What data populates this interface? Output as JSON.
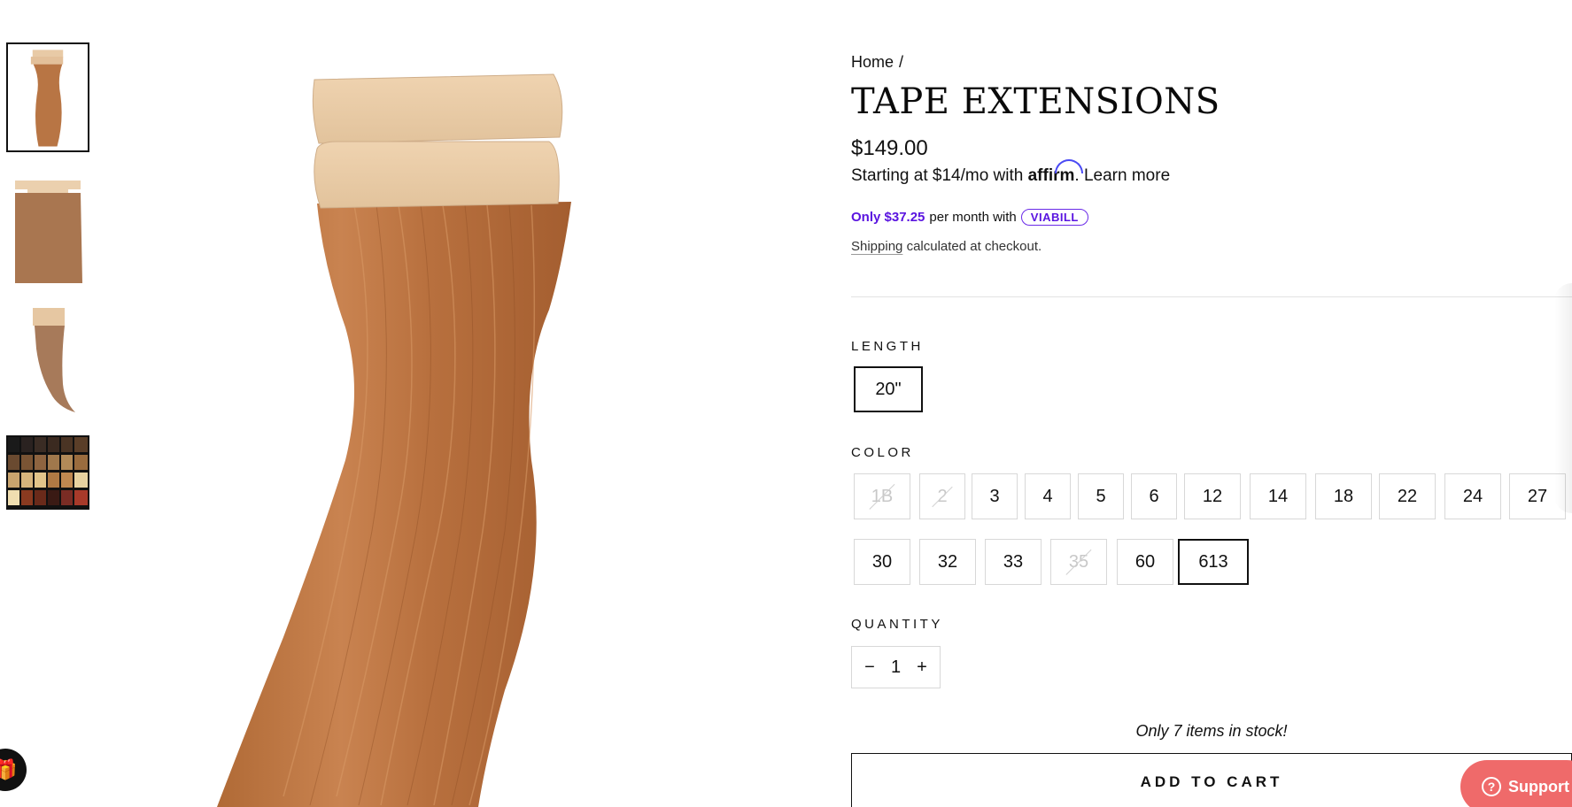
{
  "breadcrumb": {
    "home": "Home",
    "separator": "/"
  },
  "product": {
    "title": "TAPE EXTENSIONS",
    "price": "$149.00"
  },
  "affirm": {
    "prefix": "Starting at $14/mo with",
    "brand": "affirm",
    "period": ".",
    "learn_more": "Learn more"
  },
  "viabill": {
    "only": "Only $37.25",
    "middle": "per month with",
    "brand": "VIABILL"
  },
  "shipping": {
    "link": "Shipping",
    "rest": "calculated at checkout."
  },
  "length": {
    "label": "LENGTH",
    "options": [
      {
        "value": "20\"",
        "selected": true
      }
    ]
  },
  "color": {
    "label": "COLOR",
    "options": [
      {
        "value": "1B",
        "available": false
      },
      {
        "value": "2",
        "available": false
      },
      {
        "value": "3",
        "available": true
      },
      {
        "value": "4",
        "available": true
      },
      {
        "value": "5",
        "available": true
      },
      {
        "value": "6",
        "available": true
      },
      {
        "value": "12",
        "available": true
      },
      {
        "value": "14",
        "available": true
      },
      {
        "value": "18",
        "available": true
      },
      {
        "value": "22",
        "available": true
      },
      {
        "value": "24",
        "available": true
      },
      {
        "value": "27",
        "available": true
      },
      {
        "value": "30",
        "available": true
      },
      {
        "value": "32",
        "available": true
      },
      {
        "value": "33",
        "available": true
      },
      {
        "value": "35",
        "available": false
      },
      {
        "value": "60",
        "available": true
      },
      {
        "value": "613",
        "available": true,
        "selected": true
      }
    ]
  },
  "quantity": {
    "label": "QUANTITY",
    "minus": "−",
    "value": "1",
    "plus": "+"
  },
  "stock_note": "Only 7 items in stock!",
  "add_to_cart": "ADD TO CART",
  "support": {
    "icon": "question-icon",
    "label": "Support"
  },
  "colors": {
    "accent_purple": "#5a14e0",
    "support_bg": "#ef6a6a",
    "hair": "#b8703e"
  }
}
